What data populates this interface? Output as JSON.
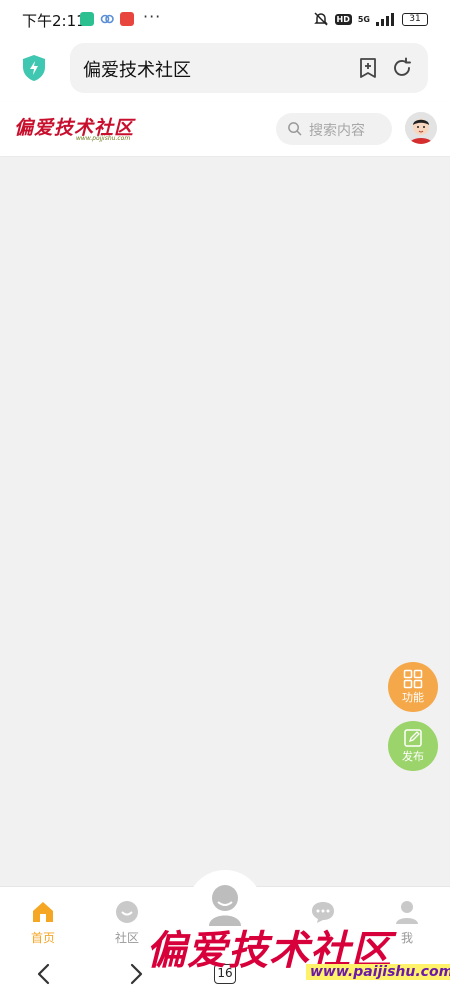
{
  "status_bar": {
    "time": "下午2:11",
    "dots": "···",
    "hd_badge": "HD",
    "network": "5G",
    "battery": "31",
    "icons": [
      "wechat-app-icon",
      "link-app-icon",
      "red-app-icon",
      "mute-bell-icon",
      "hd-icon",
      "signal-icon",
      "battery-icon"
    ]
  },
  "browser": {
    "address_text": "偏爱技术社区",
    "icons": [
      "shield-icon",
      "bookmark-add-icon",
      "refresh-icon"
    ]
  },
  "site": {
    "logo_text": "偏爱技术社区",
    "logo_url": "www.pojjishu.com",
    "search_placeholder": "搜索内容"
  },
  "fabs": {
    "function_label": "功能",
    "post_label": "发布"
  },
  "tabbar": {
    "tabs": [
      {
        "label": "首页",
        "icon": "home-icon",
        "active": true
      },
      {
        "label": "社区",
        "icon": "community-icon",
        "active": false
      },
      {
        "label": "",
        "icon": "center-avatar-icon",
        "active": false
      },
      {
        "label": "",
        "icon": "message-icon",
        "active": false
      },
      {
        "label": "我",
        "icon": "user-icon",
        "active": false
      }
    ]
  },
  "navbar": {
    "tab_count": "16"
  },
  "watermark": {
    "text": "偏爱技术社区",
    "url": "www.paijishu.com"
  },
  "colors": {
    "accent_orange": "#f5a623",
    "fab_orange": "#f5a84a",
    "fab_green": "#9bd46a",
    "shield_teal": "#3fc7b1",
    "logo_red": "#c8102e",
    "logo_blue": "#2b3db0"
  }
}
